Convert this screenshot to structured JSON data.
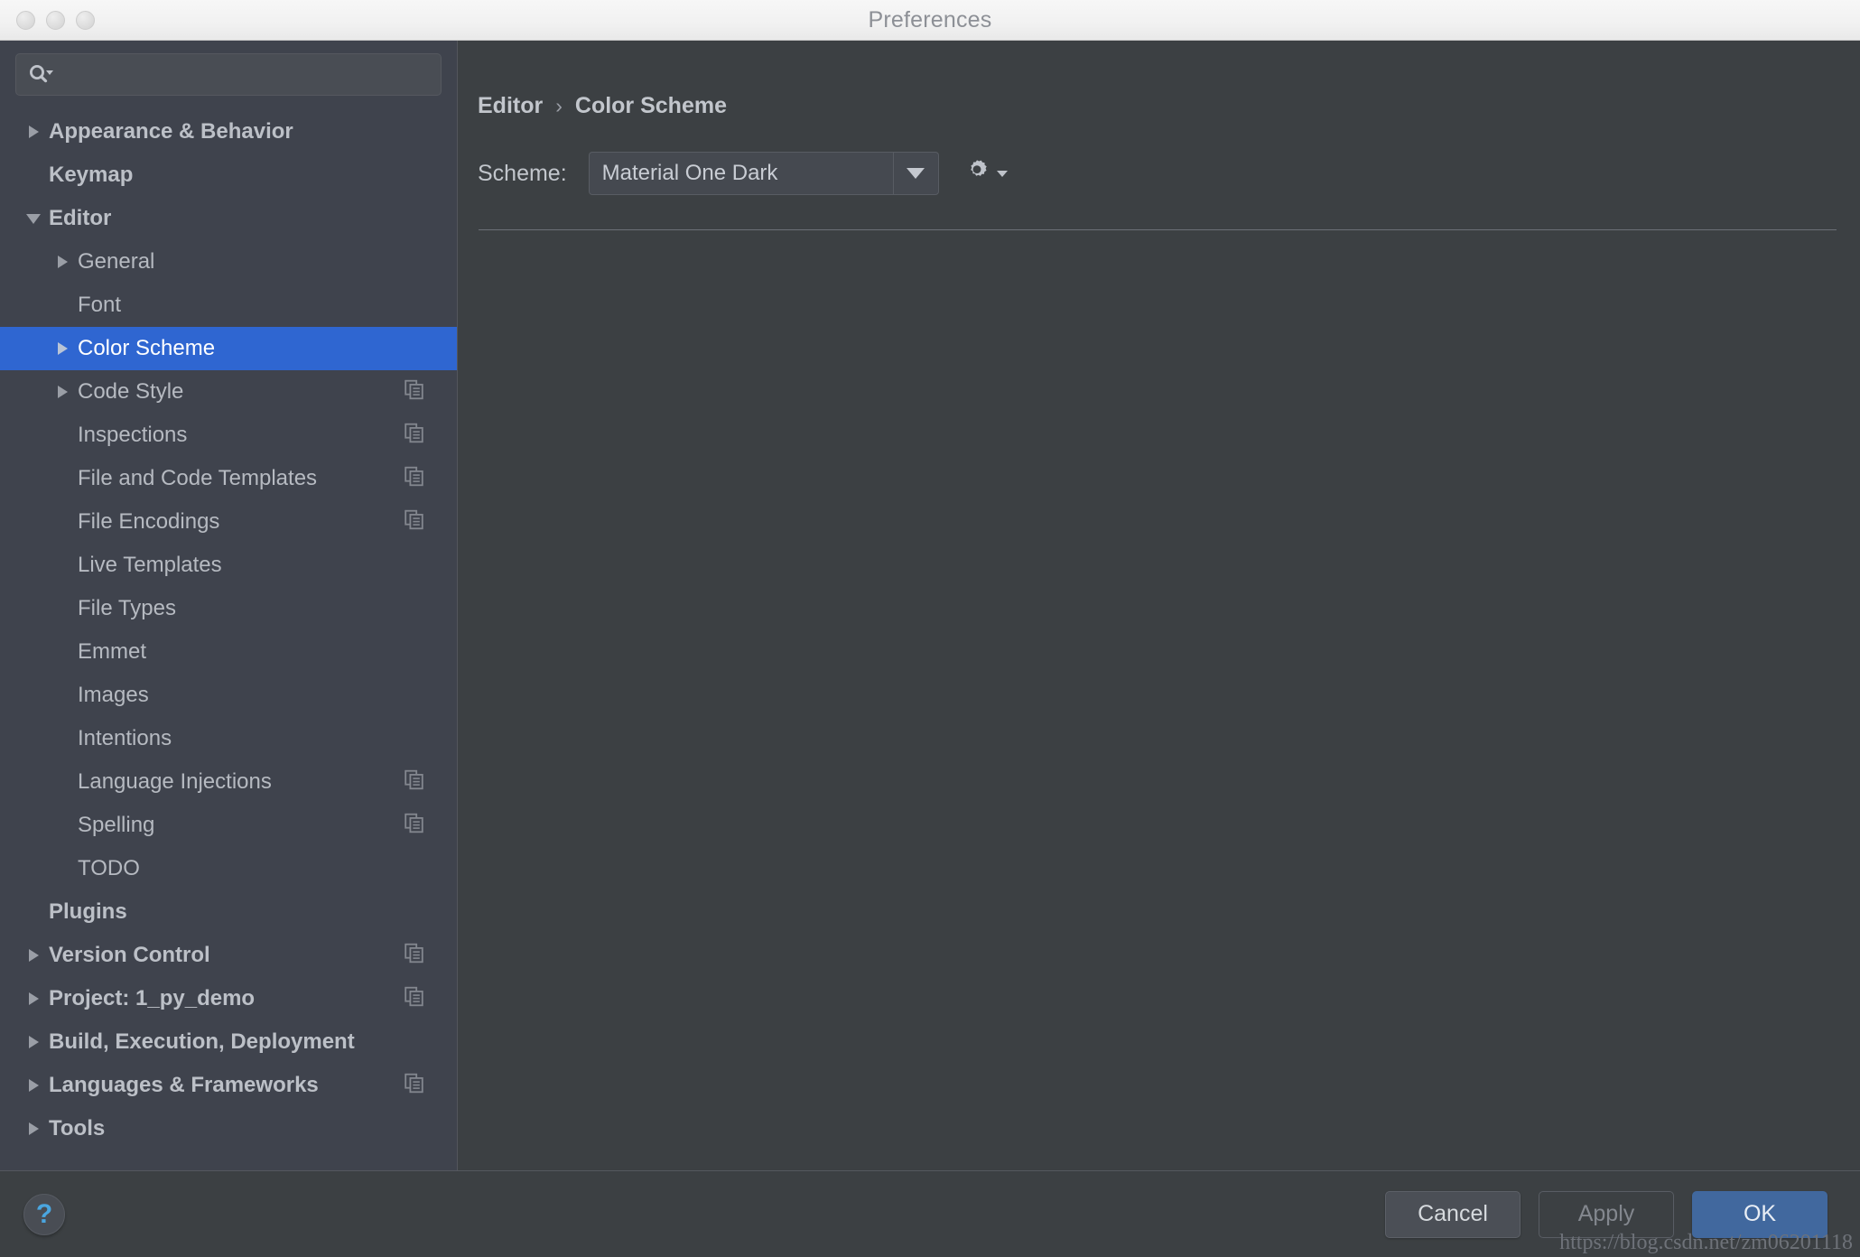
{
  "window": {
    "title": "Preferences",
    "traffic_lights": [
      "close-button",
      "minimize-button",
      "zoom-button"
    ]
  },
  "sidebar": {
    "search": {
      "value": "",
      "placeholder": ""
    },
    "items": [
      {
        "label": "Appearance & Behavior",
        "level": 0,
        "arrow": "collapsed",
        "copy": false,
        "selected": false
      },
      {
        "label": "Keymap",
        "level": 0,
        "arrow": "none",
        "copy": false,
        "selected": false
      },
      {
        "label": "Editor",
        "level": 0,
        "arrow": "expanded",
        "copy": false,
        "selected": false
      },
      {
        "label": "General",
        "level": 1,
        "arrow": "collapsed",
        "copy": false,
        "selected": false
      },
      {
        "label": "Font",
        "level": 1,
        "arrow": "none",
        "copy": false,
        "selected": false
      },
      {
        "label": "Color Scheme",
        "level": 1,
        "arrow": "collapsed",
        "copy": false,
        "selected": true
      },
      {
        "label": "Code Style",
        "level": 1,
        "arrow": "collapsed",
        "copy": true,
        "selected": false
      },
      {
        "label": "Inspections",
        "level": 1,
        "arrow": "none",
        "copy": true,
        "selected": false
      },
      {
        "label": "File and Code Templates",
        "level": 1,
        "arrow": "none",
        "copy": true,
        "selected": false
      },
      {
        "label": "File Encodings",
        "level": 1,
        "arrow": "none",
        "copy": true,
        "selected": false
      },
      {
        "label": "Live Templates",
        "level": 1,
        "arrow": "none",
        "copy": false,
        "selected": false
      },
      {
        "label": "File Types",
        "level": 1,
        "arrow": "none",
        "copy": false,
        "selected": false
      },
      {
        "label": "Emmet",
        "level": 1,
        "arrow": "none",
        "copy": false,
        "selected": false
      },
      {
        "label": "Images",
        "level": 1,
        "arrow": "none",
        "copy": false,
        "selected": false
      },
      {
        "label": "Intentions",
        "level": 1,
        "arrow": "none",
        "copy": false,
        "selected": false
      },
      {
        "label": "Language Injections",
        "level": 1,
        "arrow": "none",
        "copy": true,
        "selected": false
      },
      {
        "label": "Spelling",
        "level": 1,
        "arrow": "none",
        "copy": true,
        "selected": false
      },
      {
        "label": "TODO",
        "level": 1,
        "arrow": "none",
        "copy": false,
        "selected": false
      },
      {
        "label": "Plugins",
        "level": 0,
        "arrow": "none",
        "copy": false,
        "selected": false
      },
      {
        "label": "Version Control",
        "level": 0,
        "arrow": "collapsed",
        "copy": true,
        "selected": false
      },
      {
        "label": "Project: 1_py_demo",
        "level": 0,
        "arrow": "collapsed",
        "copy": true,
        "selected": false
      },
      {
        "label": "Build, Execution, Deployment",
        "level": 0,
        "arrow": "collapsed",
        "copy": false,
        "selected": false
      },
      {
        "label": "Languages & Frameworks",
        "level": 0,
        "arrow": "collapsed",
        "copy": true,
        "selected": false
      },
      {
        "label": "Tools",
        "level": 0,
        "arrow": "collapsed",
        "copy": false,
        "selected": false
      }
    ]
  },
  "main": {
    "breadcrumb": {
      "parent": "Editor",
      "separator": "›",
      "current": "Color Scheme"
    },
    "scheme": {
      "label": "Scheme:",
      "value": "Material One Dark",
      "options": [
        "Material One Dark"
      ],
      "gear_tooltip": "Show Scheme Actions"
    }
  },
  "footer": {
    "help_label": "?",
    "cancel_label": "Cancel",
    "apply_label": "Apply",
    "ok_label": "OK"
  },
  "watermark": "https://blog.csdn.net/zm06201118",
  "colors": {
    "selection_blue": "#2f66d1",
    "ok_button_blue": "#41689e",
    "sidebar_bg": "#3f434d",
    "main_bg": "#3c4043",
    "titlebar_bg": "#f1f1f1",
    "text": "#b9bdc4",
    "help_glyph_blue": "#4aa6e0"
  }
}
